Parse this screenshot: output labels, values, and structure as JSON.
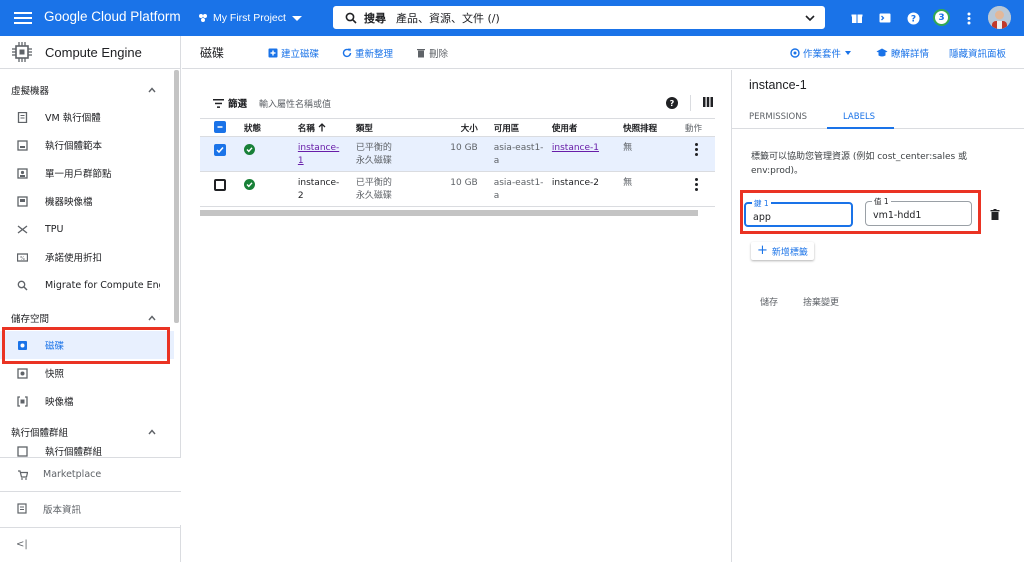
{
  "topbar": {
    "brand": "Google Cloud Platform",
    "project": "My First Project",
    "search_label": "搜尋",
    "search_hint": "產品、資源、文件 (/)",
    "notification_count": "3"
  },
  "sidebar": {
    "title": "Compute Engine",
    "sections": [
      {
        "label": "虛擬機器"
      },
      {
        "label": "儲存空間"
      },
      {
        "label": "執行個體群組"
      }
    ],
    "vm_items": [
      {
        "label": "VM 執行個體",
        "icon": "vm-icon"
      },
      {
        "label": "執行個體範本",
        "icon": "template-icon"
      },
      {
        "label": "單一用戶群節點",
        "icon": "sole-tenant-icon"
      },
      {
        "label": "機器映像檔",
        "icon": "machine-image-icon"
      },
      {
        "label": "TPU",
        "icon": "tpu-icon"
      },
      {
        "label": "承諾使用折扣",
        "icon": "discount-icon"
      },
      {
        "label": "Migrate for Compute Engine",
        "icon": "migrate-icon"
      }
    ],
    "storage_items": [
      {
        "label": "磁碟",
        "icon": "disk-icon",
        "active": true
      },
      {
        "label": "快照",
        "icon": "snapshot-icon"
      },
      {
        "label": "映像檔",
        "icon": "image-icon"
      }
    ],
    "group_items": [
      {
        "label": "執行個體群組",
        "icon": "instance-group-icon"
      }
    ],
    "footer": [
      {
        "label": "Marketplace",
        "icon": "marketplace-icon"
      },
      {
        "label": "版本資訊",
        "icon": "release-notes-icon"
      }
    ],
    "collapse_label": "<|"
  },
  "pagebar": {
    "title": "磁碟",
    "create": "建立磁碟",
    "refresh": "重新整理",
    "delete": "刪除",
    "suite": "作業套件",
    "learn": "瞭解詳情",
    "hide_panel": "隱藏資訊面板"
  },
  "filter": {
    "label": "篩選",
    "placeholder": "輸入屬性名稱或值",
    "help": "?"
  },
  "table": {
    "headers": [
      "狀態",
      "名稱",
      "類型",
      "大小",
      "可用區",
      "使用者",
      "快照排程",
      "動作"
    ],
    "rows": [
      {
        "selected": true,
        "name_1": "instance-",
        "name_2": "1",
        "type_1": "已平衡的",
        "type_2": "永久磁碟",
        "size": "10 GB",
        "zone_1": "asia-east1-",
        "zone_2": "a",
        "user": "instance-1",
        "schedule": "無"
      },
      {
        "selected": false,
        "name_1": "instance-",
        "name_2": "2",
        "type_1": "已平衡的",
        "type_2": "永久磁碟",
        "size": "10 GB",
        "zone_1": "asia-east1-",
        "zone_2": "a",
        "user": "instance-2",
        "schedule": "無"
      }
    ]
  },
  "panel": {
    "title": "instance-1",
    "tabs": [
      "PERMISSIONS",
      "LABELS"
    ],
    "active_tab": "LABELS",
    "description": "標籤可以協助您管理資源 (例如 cost_center:sales 或 env:prod)。",
    "key_label": "鍵 1",
    "key_value": "app",
    "value_label": "值 1",
    "value_value": "vm1-hdd1",
    "add_label": "新增標籤",
    "save": "儲存",
    "discard": "捨棄變更"
  },
  "colors": {
    "accent": "#1a73e8",
    "highlight": "#ea3323",
    "status_ok": "#188038",
    "visited_link": "#681da8"
  }
}
